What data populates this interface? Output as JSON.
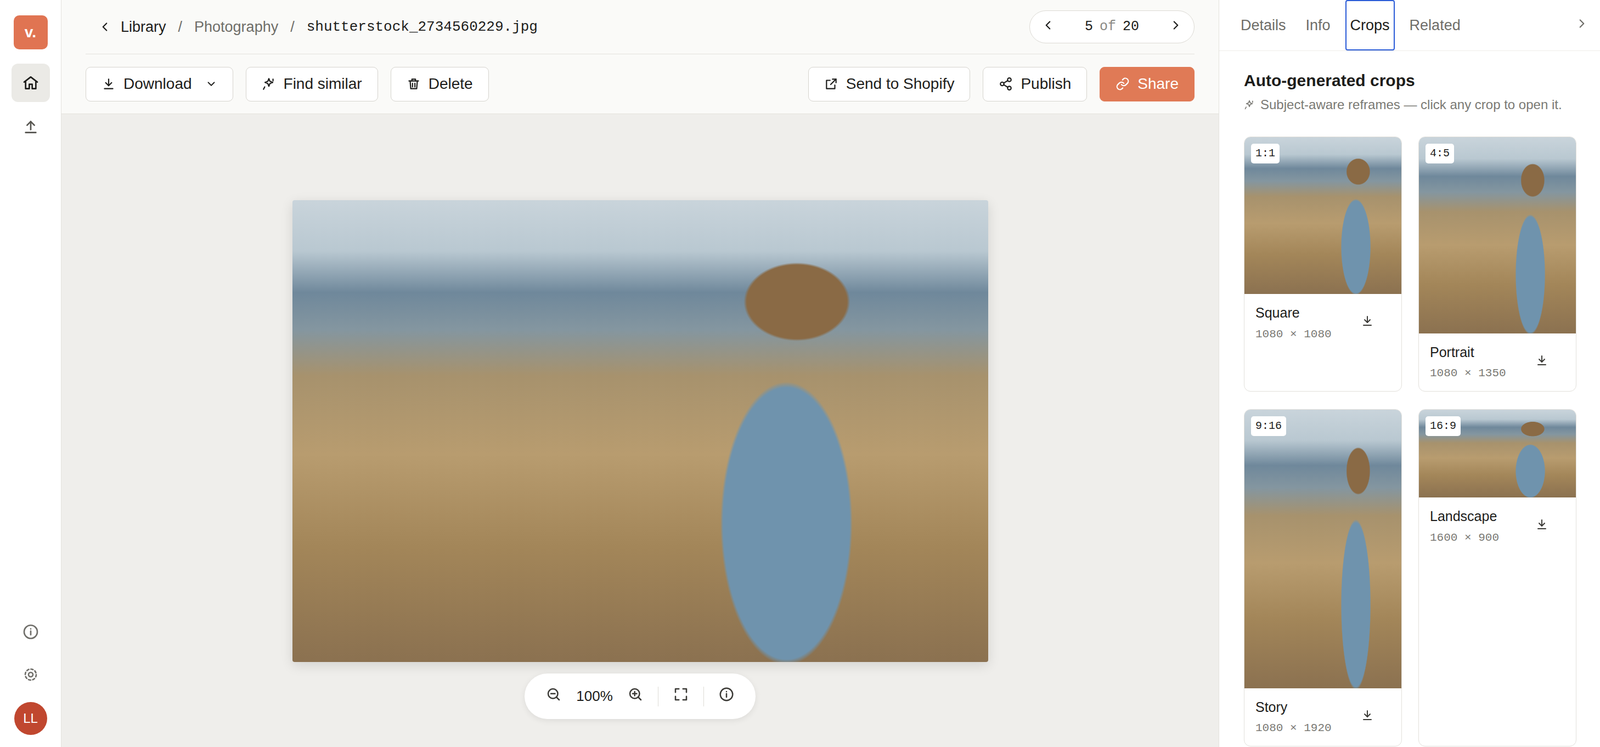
{
  "app": {
    "logo": "v.",
    "avatar": "LL"
  },
  "rail": {
    "items": [
      {
        "selected": true
      },
      {
        "selected": false
      }
    ]
  },
  "breadcrumb": {
    "back": "Library",
    "separator": "/",
    "path": [
      "Photography"
    ],
    "current": "shutterstock_2734560229.jpg"
  },
  "pager": {
    "index": "5",
    "of": "of",
    "total": "20"
  },
  "toolbar": {
    "left": [
      {
        "label": "Download",
        "dropdown": true
      },
      {
        "label": "Find similar",
        "dropdown": false
      },
      {
        "label": "Delete",
        "dropdown": false
      }
    ],
    "right": [
      {
        "label": "Send to Shopify",
        "primary": false
      },
      {
        "label": "Publish",
        "primary": false
      },
      {
        "label": "Share",
        "primary": true
      }
    ]
  },
  "viewer": {
    "zoom": "100%"
  },
  "panel": {
    "tabs": [
      {
        "label": "Details",
        "selected": false
      },
      {
        "label": "Info",
        "selected": false
      },
      {
        "label": "Crops",
        "selected": true
      },
      {
        "label": "Related",
        "selected": false
      }
    ],
    "heading": "Auto-generated crops",
    "subtitle": "Subject-aware reframes — click any crop to open it.",
    "crops": [
      {
        "ratio": "1:1",
        "label": "Square",
        "size": "1080 × 1080"
      },
      {
        "ratio": "4:5",
        "label": "Portrait",
        "size": "1080 × 1350"
      },
      {
        "ratio": "9:16",
        "label": "Story",
        "size": "1080 × 1920"
      },
      {
        "ratio": "16:9",
        "label": "Landscape",
        "size": "1600 × 900"
      }
    ]
  }
}
